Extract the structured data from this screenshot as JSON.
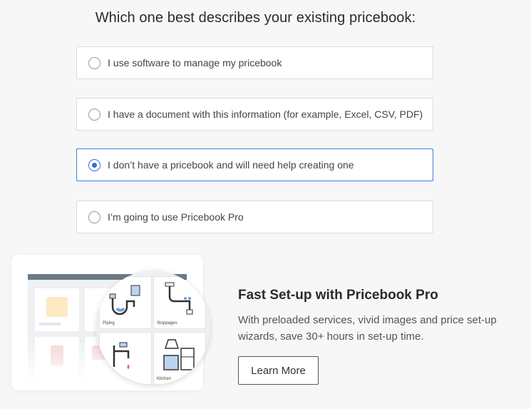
{
  "question": "Which one best describes your existing pricebook:",
  "options": [
    {
      "label": "I use software to manage my pricebook",
      "selected": false
    },
    {
      "label": "I have a document with this information (for example, Excel, CSV, PDF)",
      "selected": false
    },
    {
      "label": "I don’t have a pricebook and will need help creating one",
      "selected": true
    },
    {
      "label": "I’m going to use Pricebook Pro",
      "selected": false
    }
  ],
  "promo": {
    "title": "Fast Set-up with Pricebook Pro",
    "text": "With preloaded services, vivid images and price set-up wizards, save 30+ hours in set-up time.",
    "button_label": "Learn More",
    "tiles": [
      "Piping",
      "Stoppages",
      "",
      "Kitchen"
    ]
  },
  "colors": {
    "accent": "#2f6fd6",
    "selected_border": "#3b7dd8"
  }
}
